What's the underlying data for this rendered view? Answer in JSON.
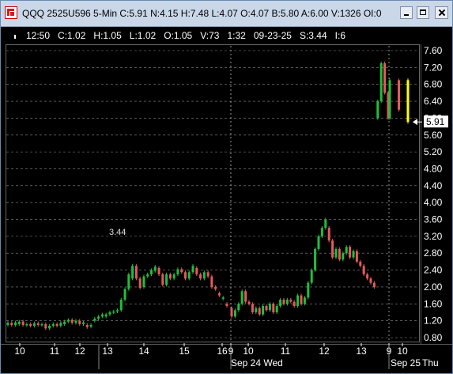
{
  "window": {
    "title": "QQQ 2525U596 5-Min C:5.91 N:4.15 H:7.48 L:4.07 O:4.07 B:5.80 A:6.00 V:1326 OI:0"
  },
  "infobar": {
    "time": "12:50",
    "close": "C:1.02",
    "high": "H:1.05",
    "low": "L:1.02",
    "open": "O:1.05",
    "volume": "V:73",
    "ratio": "1:32",
    "date": "09-23-25",
    "s": "S:3.44",
    "i": "I:6"
  },
  "icons": [
    "app-icon",
    "minimize-icon",
    "maximize-icon",
    "close-icon",
    "pin-icon",
    "price-pointer-icon"
  ],
  "colors": {
    "up": "#1fbf3b",
    "down": "#e55a5a",
    "current": "#ffff00",
    "grid": "#8a8a8a",
    "background": "#000000"
  },
  "chart_data": {
    "type": "candlestick",
    "y_ticks": [
      "7.60",
      "7.20",
      "6.80",
      "6.40",
      "6.00",
      "5.60",
      "5.20",
      "4.80",
      "4.40",
      "4.00",
      "3.60",
      "3.20",
      "2.80",
      "2.40",
      "2.00",
      "1.60",
      "1.20",
      "0.80"
    ],
    "ylim": [
      0.8,
      7.6
    ],
    "x_ticks": [
      "10",
      "11",
      "12",
      "13",
      "14",
      "15",
      "16",
      "9",
      "10",
      "11",
      "12",
      "13",
      "9",
      "10"
    ],
    "x_date_labels": [
      "Sep 24 Wed",
      "Sep 25",
      "Thu"
    ],
    "annotation": "3.44",
    "current_price": "5.91",
    "series": [
      {
        "o": 1.1,
        "c": 1.15
      },
      {
        "o": 1.15,
        "c": 1.1
      },
      {
        "o": 1.1,
        "c": 1.16
      },
      {
        "o": 1.12,
        "c": 1.18
      },
      {
        "o": 1.18,
        "c": 1.1
      },
      {
        "o": 1.1,
        "c": 1.12
      },
      {
        "o": 1.12,
        "c": 1.08
      },
      {
        "o": 1.08,
        "c": 1.14
      },
      {
        "o": 1.14,
        "c": 1.1
      },
      {
        "o": 1.1,
        "c": 1.12
      },
      {
        "o": 1.12,
        "c": 1.02
      },
      {
        "o": 1.02,
        "c": 1.08
      },
      {
        "o": 1.08,
        "c": 1.12
      },
      {
        "o": 1.12,
        "c": 1.08
      },
      {
        "o": 1.08,
        "c": 1.15
      },
      {
        "o": 1.12,
        "c": 1.18
      },
      {
        "o": 1.18,
        "c": 1.22
      },
      {
        "o": 1.22,
        "c": 1.15
      },
      {
        "o": 1.15,
        "c": 1.2
      },
      {
        "o": 1.2,
        "c": 1.12
      },
      {
        "o": 1.12,
        "c": 1.16
      },
      {
        "o": 1.1,
        "c": 1.05
      },
      {
        "o": 1.06,
        "c": 1.1
      },
      {
        "o": 1.2,
        "c": 1.25
      },
      {
        "o": 1.25,
        "c": 1.3
      },
      {
        "o": 1.3,
        "c": 1.35
      },
      {
        "o": 1.3,
        "c": 1.35
      },
      {
        "o": 1.35,
        "c": 1.4
      },
      {
        "o": 1.4,
        "c": 1.42
      },
      {
        "o": 1.42,
        "c": 1.45
      },
      {
        "o": 1.45,
        "c": 1.7
      },
      {
        "o": 1.7,
        "c": 1.95
      },
      {
        "o": 1.95,
        "c": 2.3
      },
      {
        "o": 2.2,
        "c": 2.5
      },
      {
        "o": 2.5,
        "c": 2.2
      },
      {
        "o": 2.2,
        "c": 1.98
      },
      {
        "o": 2.0,
        "c": 2.25
      },
      {
        "o": 2.25,
        "c": 2.3
      },
      {
        "o": 2.3,
        "c": 2.4
      },
      {
        "o": 2.38,
        "c": 2.48
      },
      {
        "o": 2.45,
        "c": 2.3
      },
      {
        "o": 2.3,
        "c": 2.05
      },
      {
        "o": 2.05,
        "c": 2.3
      },
      {
        "o": 2.3,
        "c": 2.2
      },
      {
        "o": 2.2,
        "c": 2.3
      },
      {
        "o": 2.3,
        "c": 2.42
      },
      {
        "o": 2.42,
        "c": 2.35
      },
      {
        "o": 2.35,
        "c": 2.2
      },
      {
        "o": 2.2,
        "c": 2.35
      },
      {
        "o": 2.35,
        "c": 2.5
      },
      {
        "o": 2.45,
        "c": 2.3
      },
      {
        "o": 2.3,
        "c": 2.2
      },
      {
        "o": 2.2,
        "c": 2.35
      },
      {
        "o": 2.35,
        "c": 2.25
      },
      {
        "o": 2.25,
        "c": 2.0
      },
      {
        "o": 2.0,
        "c": 1.95
      },
      {
        "o": 1.85,
        "c": 1.8
      },
      {
        "o": 1.72,
        "c": 1.75
      },
      {
        "o": 1.6,
        "c": 1.55
      },
      {
        "o": 1.5,
        "c": 1.3
      },
      {
        "o": 1.3,
        "c": 1.45
      },
      {
        "o": 1.45,
        "c": 1.6
      },
      {
        "o": 1.6,
        "c": 1.9
      },
      {
        "o": 1.9,
        "c": 1.65
      },
      {
        "o": 1.65,
        "c": 1.6
      },
      {
        "o": 1.6,
        "c": 1.4
      },
      {
        "o": 1.4,
        "c": 1.5
      },
      {
        "o": 1.5,
        "c": 1.35
      },
      {
        "o": 1.35,
        "c": 1.55
      },
      {
        "o": 1.55,
        "c": 1.45
      },
      {
        "o": 1.45,
        "c": 1.6
      },
      {
        "o": 1.6,
        "c": 1.4
      },
      {
        "o": 1.4,
        "c": 1.55
      },
      {
        "o": 1.55,
        "c": 1.7
      },
      {
        "o": 1.7,
        "c": 1.6
      },
      {
        "o": 1.6,
        "c": 1.7
      },
      {
        "o": 1.7,
        "c": 1.65
      },
      {
        "o": 1.65,
        "c": 1.55
      },
      {
        "o": 1.55,
        "c": 1.8
      },
      {
        "o": 1.8,
        "c": 1.6
      },
      {
        "o": 1.6,
        "c": 1.75
      },
      {
        "o": 1.75,
        "c": 2.1
      },
      {
        "o": 2.1,
        "c": 2.4
      },
      {
        "o": 2.4,
        "c": 2.9
      },
      {
        "o": 2.9,
        "c": 3.2
      },
      {
        "o": 3.2,
        "c": 3.4
      },
      {
        "o": 3.4,
        "c": 3.6
      },
      {
        "o": 3.4,
        "c": 3.1
      },
      {
        "o": 3.1,
        "c": 2.7
      },
      {
        "o": 2.7,
        "c": 2.9
      },
      {
        "o": 2.9,
        "c": 2.65
      },
      {
        "o": 2.65,
        "c": 2.8
      },
      {
        "o": 2.8,
        "c": 2.95
      },
      {
        "o": 2.95,
        "c": 2.7
      },
      {
        "o": 2.7,
        "c": 2.85
      },
      {
        "o": 2.85,
        "c": 2.6
      },
      {
        "o": 2.6,
        "c": 2.5
      },
      {
        "o": 2.5,
        "c": 2.3
      },
      {
        "o": 2.3,
        "c": 2.2
      },
      {
        "o": 2.2,
        "c": 2.1
      },
      {
        "o": 2.1,
        "c": 2.0
      },
      {
        "o": 6.0,
        "c": 6.4
      },
      {
        "o": 6.4,
        "c": 7.3
      },
      {
        "o": 7.3,
        "c": 6.6
      },
      {
        "o": 6.6,
        "c": 6.0
      },
      {
        "o": 6.0,
        "c": 6.9
      },
      {
        "o": 6.9,
        "c": 6.2
      },
      {
        "o": 6.9,
        "c": 5.91,
        "current": true
      }
    ]
  }
}
